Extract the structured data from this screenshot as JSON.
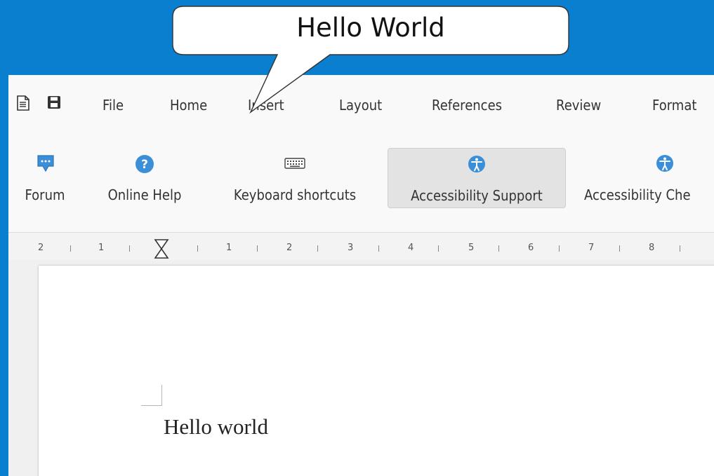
{
  "callout": {
    "text": "Hello World"
  },
  "menubar": {
    "icons": [
      {
        "name": "document-icon"
      },
      {
        "name": "save-icon"
      }
    ],
    "items": [
      {
        "label": "File"
      },
      {
        "label": "Home"
      },
      {
        "label": "Insert"
      },
      {
        "label": "Layout"
      },
      {
        "label": "References"
      },
      {
        "label": "Review"
      },
      {
        "label": "Format"
      }
    ]
  },
  "toolbar": {
    "buttons": [
      {
        "label": "Forum",
        "icon": "forum-icon",
        "active": false
      },
      {
        "label": "Online Help",
        "icon": "help-icon",
        "active": false
      },
      {
        "label": "Keyboard shortcuts",
        "icon": "keyboard-icon",
        "active": false
      },
      {
        "label": "Accessibility Support",
        "icon": "accessibility-icon",
        "active": true
      },
      {
        "label": "Accessibility Che",
        "icon": "accessibility-check-icon",
        "active": false
      }
    ]
  },
  "ruler": {
    "numbers": [
      "2",
      "1",
      "1",
      "2",
      "3",
      "4",
      "5",
      "6",
      "7",
      "8"
    ]
  },
  "document": {
    "text": "Hello world"
  },
  "colors": {
    "desktop": "#0a7fcf",
    "icon_blue": "#3b8fd9",
    "active_button": "#e3e3e3"
  }
}
